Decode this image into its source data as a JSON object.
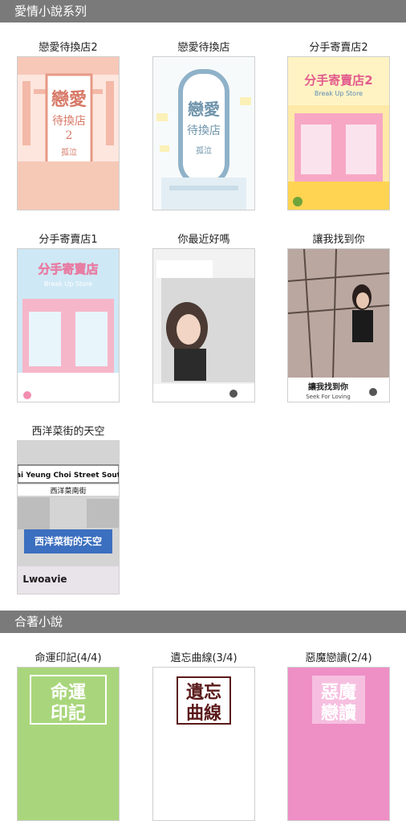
{
  "sections": [
    {
      "title": "愛情小說系列",
      "books": [
        {
          "title": "戀愛待換店2",
          "cover_text": [
            "戀愛",
            "待換店",
            "2",
            "孤泣"
          ]
        },
        {
          "title": "戀愛待換店",
          "cover_text": [
            "戀愛",
            "待換店",
            "孤泣"
          ]
        },
        {
          "title": "分手寄賣店2",
          "cover_text": [
            "分手寄賣店2",
            "Break Up Store"
          ]
        },
        {
          "title": "分手寄賣店1",
          "cover_text": [
            "分手寄賣店",
            "Break Up Store"
          ]
        },
        {
          "title": "你最近好嗎",
          "cover_text": []
        },
        {
          "title": "讓我找到你",
          "cover_text": [
            "讓我找到你",
            "Seek For Loving"
          ]
        },
        {
          "title": "西洋菜街的天空",
          "cover_text": [
            "Sai Yeung Choi Street South",
            "西洋菜南街",
            "西洋菜街的天空",
            "Lwoavie"
          ]
        }
      ]
    },
    {
      "title": "合著小說",
      "books": [
        {
          "title": "命運印記(4/4)",
          "cover_text": [
            "命運",
            "印記"
          ]
        },
        {
          "title": "遺忘曲線(3/4)",
          "cover_text": [
            "遺忘",
            "曲線"
          ]
        },
        {
          "title": "惡魔戀讀(2/4)",
          "cover_text": [
            "惡魔",
            "戀讀"
          ]
        }
      ]
    }
  ],
  "colors": {
    "header_bg": "#7a7a7a",
    "cover_pink": "#f4b9a8",
    "cover_blue": "#8fb2c9",
    "cover_green": "#a9d67c",
    "cover_magenta": "#ee8fc6"
  }
}
